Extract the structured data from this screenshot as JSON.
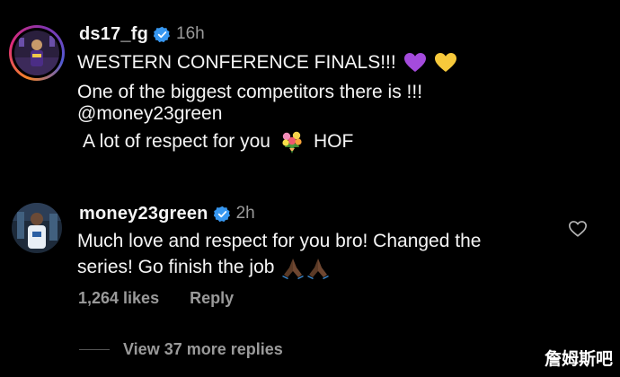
{
  "comments": [
    {
      "username": "ds17_fg",
      "time": "16h",
      "lines": [
        "WESTERN CONFERENCE FINALS!!!",
        "One of the biggest competitors there is !!!",
        "@money23green",
        "A lot of respect for you",
        "HOF"
      ]
    },
    {
      "username": "money23green",
      "time": "2h",
      "lines": [
        "Much love and respect for you bro! Changed the",
        "series! Go finish the job"
      ],
      "likes": "1,264 likes",
      "reply_label": "Reply"
    }
  ],
  "view_more": "View 37 more replies",
  "watermark": "詹姆斯吧",
  "icons": {
    "verified": "verified-badge-icon",
    "heart": "heart-outline-icon",
    "emojis": [
      "purple-heart-icon",
      "yellow-heart-icon",
      "bouquet-icon",
      "folded-hands-icon"
    ]
  },
  "colors": {
    "background": "#000000",
    "text": "#f5f5f5",
    "muted": "#9a9a9a",
    "verified": "#3797f0",
    "purple_heart": "#a44bdc",
    "yellow_heart": "#f7c93b"
  }
}
